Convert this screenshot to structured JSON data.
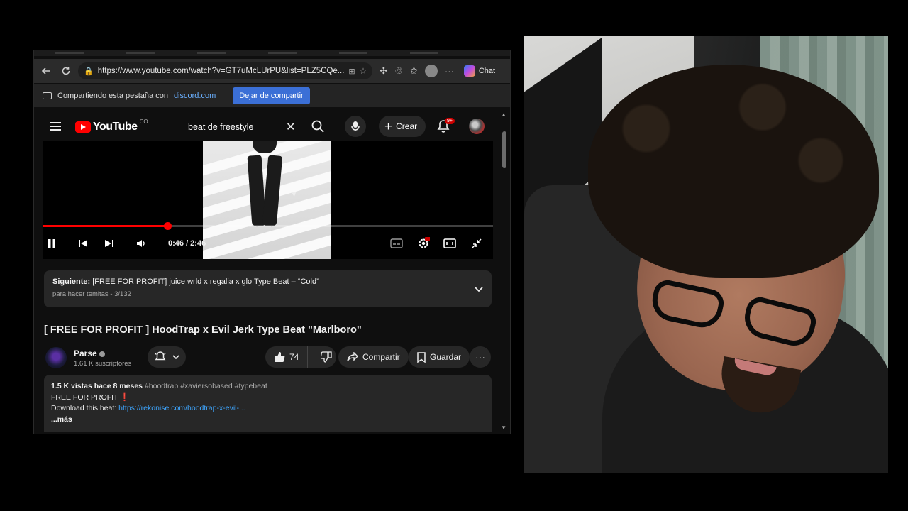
{
  "browser": {
    "url": "https://www.youtube.com/watch?v=GT7uMcLUrPU&list=PLZ5CQe...",
    "chat_label": "Chat",
    "share_bar": {
      "text": "Compartiendo esta pestaña con",
      "domain": "discord.com",
      "stop_label": "Dejar de compartir"
    }
  },
  "youtube": {
    "logo_text": "YouTube",
    "logo_country": "CO",
    "search_query": "beat de freestyle",
    "create_label": "Crear",
    "notification_count": "9+",
    "player": {
      "time_display": "0:46 / 2:46",
      "progress": 0.2771
    },
    "up_next": {
      "prefix": "Siguiente:",
      "title": "[FREE FOR PROFIT] juice wrld x regalia x glo Type Beat – “Cold”",
      "playlist": "para hacer temitas - 3/132"
    },
    "video_title": "[ FREE FOR PROFIT ] HoodTrap x Evil Jerk Type Beat \"Marlboro\"",
    "channel": {
      "name": "Parse",
      "subscribers": "1.61 K suscriptores"
    },
    "actions": {
      "like_count": "74",
      "share_label": "Compartir",
      "save_label": "Guardar"
    },
    "description": {
      "stats": "1.5 K vistas  hace 8 meses",
      "tags": "#hoodtrap #xaviersobased #typebeat",
      "line1": "FREE FOR PROFIT",
      "line1_mark": "❗",
      "line2_prefix": "Download this beat:",
      "line2_link": "https://rekonise.com/hoodtrap-x-evil-...",
      "more": "...más"
    }
  },
  "colors": {
    "yt_red": "#ff0000",
    "share_button": "#3b6fd6",
    "link_blue": "#3ea6ff"
  }
}
